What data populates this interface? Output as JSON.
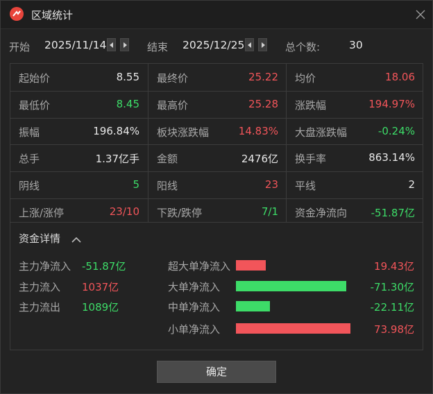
{
  "window": {
    "title": "区域统计",
    "colors": {
      "up": "#f2555a",
      "down": "#3ddc68",
      "neutral": "#e8e8e8"
    }
  },
  "dates": {
    "start_label": "开始",
    "start_value": "2025/11/14",
    "end_label": "结束",
    "end_value": "2025/12/25",
    "count_label": "总个数:",
    "count_value": "30"
  },
  "stats": [
    [
      {
        "label": "起始价",
        "value": "8.55",
        "color": "white"
      },
      {
        "label": "最终价",
        "value": "25.22",
        "color": "red"
      },
      {
        "label": "均价",
        "value": "18.06",
        "color": "red"
      }
    ],
    [
      {
        "label": "最低价",
        "value": "8.45",
        "color": "green"
      },
      {
        "label": "最高价",
        "value": "25.28",
        "color": "red"
      },
      {
        "label": "涨跌幅",
        "value": "194.97%",
        "color": "red"
      }
    ],
    [
      {
        "label": "振幅",
        "value": "196.84%",
        "color": "white"
      },
      {
        "label": "板块涨跌幅",
        "value": "14.83%",
        "color": "red"
      },
      {
        "label": "大盘涨跌幅",
        "value": "-0.24%",
        "color": "green"
      }
    ],
    [
      {
        "label": "总手",
        "value": "1.37亿手",
        "color": "white"
      },
      {
        "label": "金额",
        "value": "2476亿",
        "color": "white"
      },
      {
        "label": "换手率",
        "value": "863.14%",
        "color": "white"
      }
    ],
    [
      {
        "label": "阴线",
        "value": "5",
        "color": "green"
      },
      {
        "label": "阳线",
        "value": "23",
        "color": "red"
      },
      {
        "label": "平线",
        "value": "2",
        "color": "white"
      }
    ],
    [
      {
        "label": "上涨/涨停",
        "value": "23/10",
        "color": "red"
      },
      {
        "label": "下跌/跌停",
        "value": "7/1",
        "color": "green"
      },
      {
        "label": "资金净流向",
        "value": "-51.87亿",
        "color": "green"
      }
    ]
  ],
  "fund": {
    "title": "资金详情",
    "left": [
      {
        "label": "主力净流入",
        "value": "-51.87亿",
        "color": "green"
      },
      {
        "label": "主力流入",
        "value": "1037亿",
        "color": "red"
      },
      {
        "label": "主力流出",
        "value": "1089亿",
        "color": "green"
      }
    ],
    "right": [
      {
        "label": "超大单净流入",
        "value": "19.43亿",
        "color": "red",
        "amount": 19.43
      },
      {
        "label": "大单净流入",
        "value": "-71.30亿",
        "color": "green",
        "amount": -71.3
      },
      {
        "label": "中单净流入",
        "value": "-22.11亿",
        "color": "green",
        "amount": -22.11
      },
      {
        "label": "小单净流入",
        "value": "73.98亿",
        "color": "red",
        "amount": 73.98
      }
    ]
  },
  "confirm_label": "确定"
}
